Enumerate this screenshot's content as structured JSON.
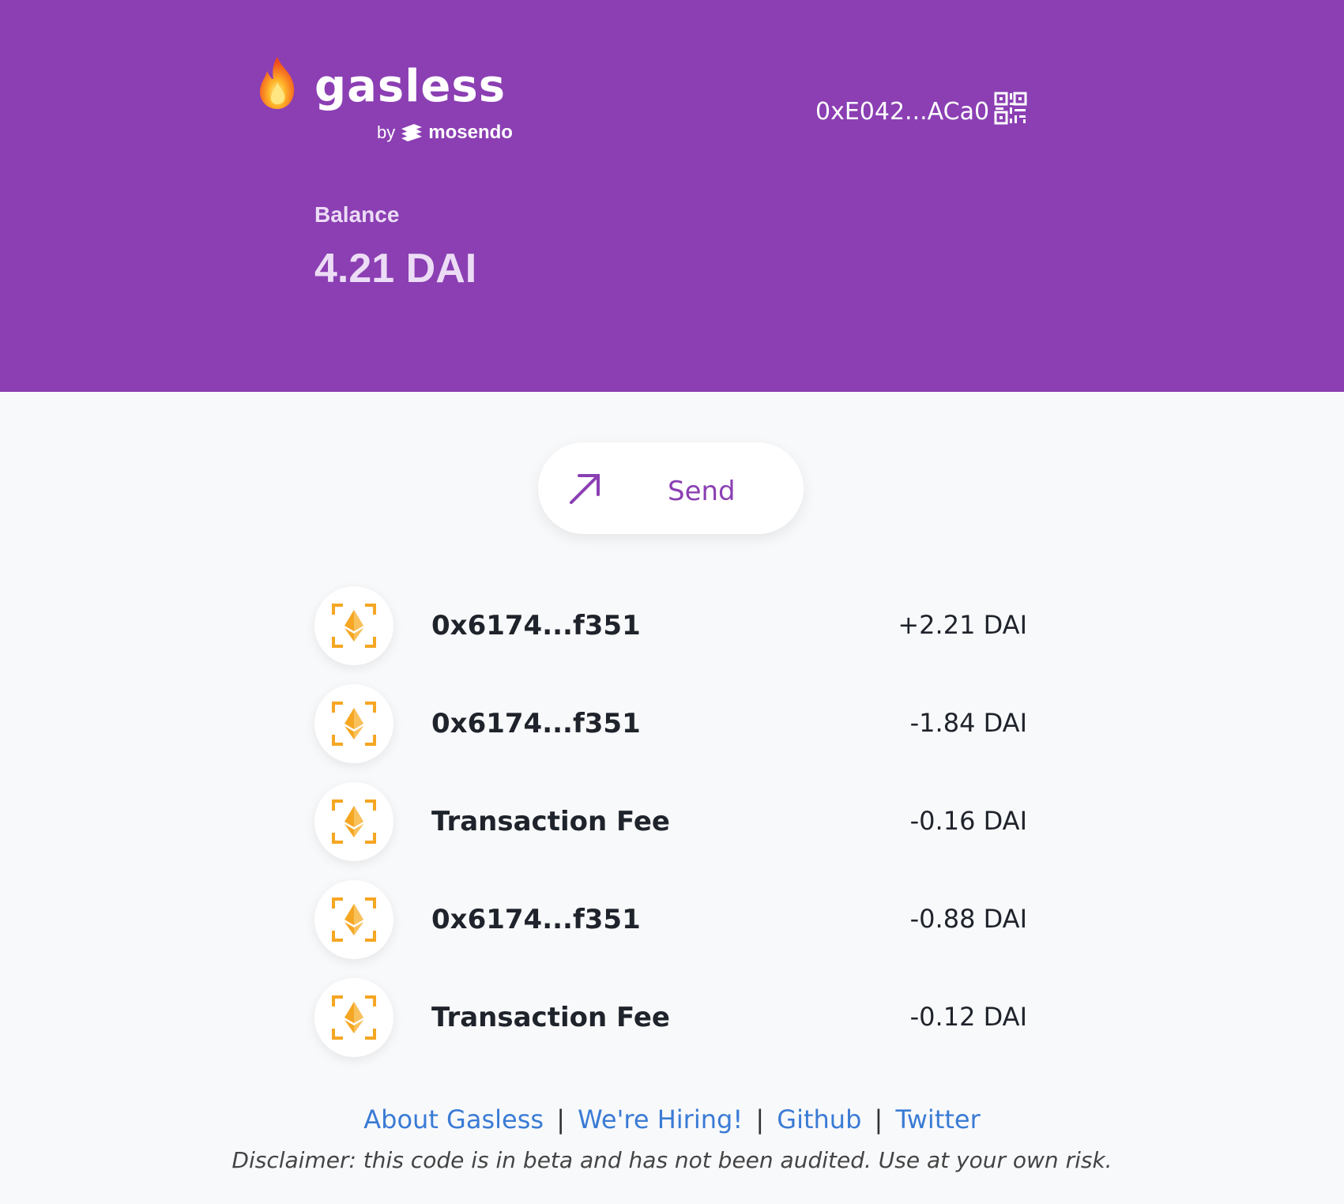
{
  "header": {
    "brand_name": "gasless",
    "by_label": "by",
    "partner_name": "mosendo",
    "wallet_address": "0xE042...ACa0",
    "balance_label": "Balance",
    "balance_value": "4.21 DAI"
  },
  "actions": {
    "send_label": "Send"
  },
  "transactions": [
    {
      "name": "0x6174...f351",
      "amount": "+2.21 DAI"
    },
    {
      "name": "0x6174...f351",
      "amount": "-1.84 DAI"
    },
    {
      "name": "Transaction Fee",
      "amount": "-0.16 DAI"
    },
    {
      "name": "0x6174...f351",
      "amount": "-0.88 DAI"
    },
    {
      "name": "Transaction Fee",
      "amount": "-0.12 DAI"
    }
  ],
  "footer": {
    "links": [
      "About Gasless",
      "We're Hiring!",
      "Github",
      "Twitter"
    ],
    "separator": "|",
    "disclaimer": "Disclaimer: this code is in beta and has not been audited. Use at your own risk."
  },
  "colors": {
    "header_bg": "#8b3fb3",
    "accent": "#8b3fb3",
    "link": "#3a7bd5",
    "eth_orange": "#f5a623"
  },
  "icons": {
    "logo": "flame-icon",
    "qr": "qr-code-icon",
    "send": "arrow-up-right-icon",
    "transaction": "ethereum-icon"
  }
}
